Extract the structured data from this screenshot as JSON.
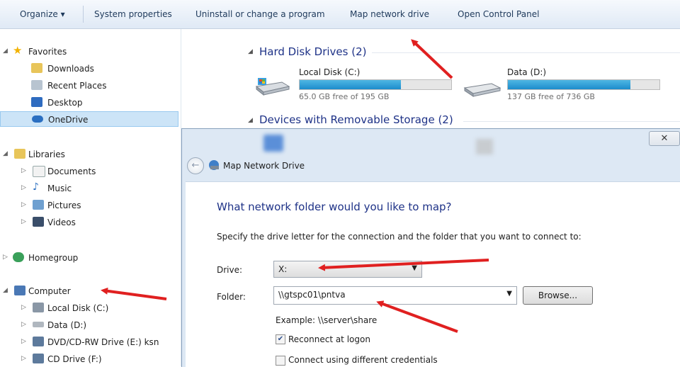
{
  "toolbar": {
    "organize": "Organize ▾",
    "system_properties": "System properties",
    "uninstall": "Uninstall or change a program",
    "map_network_drive": "Map network drive",
    "open_control_panel": "Open Control Panel"
  },
  "sidebar": {
    "favorites": "Favorites",
    "downloads": "Downloads",
    "recent_places": "Recent Places",
    "desktop": "Desktop",
    "onedrive": "OneDrive",
    "libraries": "Libraries",
    "documents": "Documents",
    "music": "Music",
    "pictures": "Pictures",
    "videos": "Videos",
    "homegroup": "Homegroup",
    "computer": "Computer",
    "local_disk": "Local Disk (C:)",
    "data": "Data (D:)",
    "dvd": "DVD/CD-RW Drive (E:) ksn",
    "cd": "CD Drive (F:)"
  },
  "content": {
    "hard_disk_header": "Hard Disk Drives (2)",
    "removable_header": "Devices with Removable Storage (2)",
    "drives": [
      {
        "name": "Local Disk (C:)",
        "free": "65.0 GB free of 195 GB",
        "used_fraction": 0.67
      },
      {
        "name": "Data (D:)",
        "free": "137 GB free of 736 GB",
        "used_fraction": 0.81
      }
    ]
  },
  "dialog": {
    "close": "✕",
    "title": "Map Network Drive",
    "heading": "What network folder would you like to map?",
    "instruction": "Specify the drive letter for the connection and the folder that you want to connect to:",
    "drive_label": "Drive:",
    "drive_value": "X:",
    "folder_label": "Folder:",
    "folder_value": "\\\\gtspc01\\pntva",
    "browse": "Browse...",
    "example": "Example: \\\\server\\share",
    "reconnect": "Reconnect at logon",
    "reconnect_checked": true,
    "different_credentials": "Connect using different credentials",
    "different_credentials_checked": false
  },
  "colors": {
    "annotation_arrow": "#e02020",
    "selection": "#cce4f7",
    "heading": "#1e3287"
  }
}
